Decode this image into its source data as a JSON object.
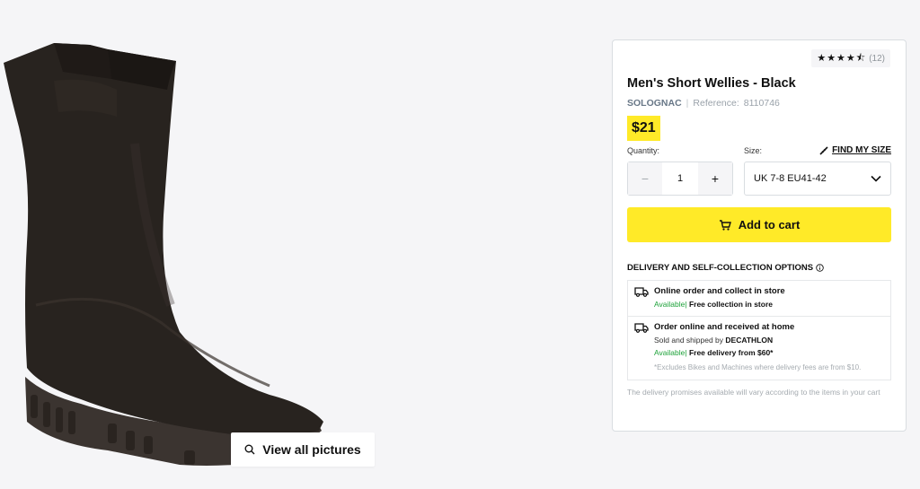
{
  "gallery": {
    "view_all_label": "View all pictures"
  },
  "product": {
    "rating_stars": "★★★★⯪",
    "review_count": "(12)",
    "title": "Men's Short Wellies - Black",
    "brand": "SOLOGNAC",
    "separator": "|",
    "reference_label": "Reference:",
    "reference_value": "8110746",
    "price": "$21"
  },
  "quantity": {
    "label": "Quantity:",
    "minus": "−",
    "value": "1",
    "plus": "+"
  },
  "size": {
    "label": "Size:",
    "find_label": "FIND MY SIZE",
    "selected": "UK 7-8 EU41-42"
  },
  "cart": {
    "add_label": "Add to cart"
  },
  "delivery": {
    "title": "DELIVERY AND SELF-COLLECTION OPTIONS",
    "options": [
      {
        "title": "Online order and collect in store",
        "available": "Available|",
        "detail": "Free collection in store"
      },
      {
        "title": "Order online and received at home",
        "sold_by_prefix": "Sold and shipped by",
        "sold_by": "DECATHLON",
        "available": "Available|",
        "detail": "Free delivery from $60*",
        "note": "*Excludes Bikes and Machines where delivery fees are from $10."
      }
    ],
    "promise": "The delivery promises available will vary according to the items in your cart"
  },
  "colors": {
    "accent": "#ffea28",
    "available": "#1ea23a",
    "border": "#d9dde1"
  }
}
